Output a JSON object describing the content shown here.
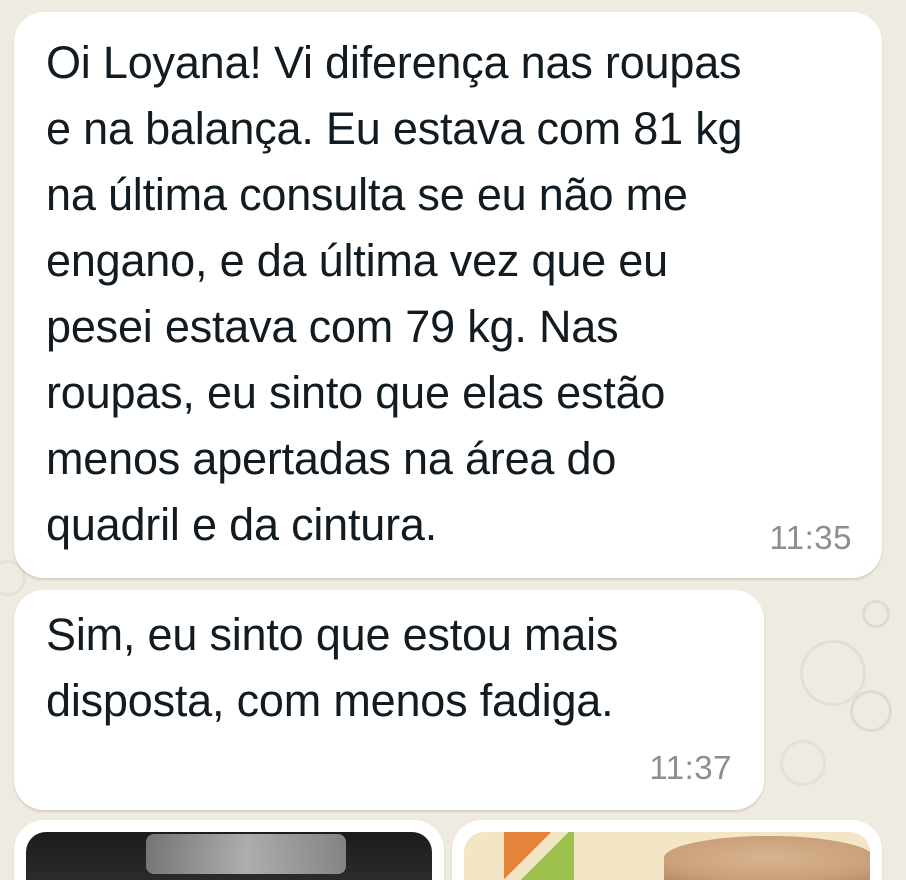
{
  "messages": [
    {
      "text": "Oi Loyana! Vi diferença nas roupas\ne na balança. Eu estava com 81 kg\nna última consulta se eu não me\nengano, e da última vez que eu\npesei estava com 79 kg. Nas\nroupas, eu sinto que elas estão\nmenos apertadas na área do\nquadril e da cintura.",
      "time": "11:35"
    },
    {
      "text": "Sim, eu sinto que estou mais\ndisposta, com menos fadiga.",
      "time": "11:37"
    }
  ],
  "media": [
    {
      "icon": "photo-thumbnail"
    },
    {
      "icon": "photo-thumbnail"
    }
  ],
  "colors": {
    "background": "#efeae2",
    "bubble": "#ffffff",
    "text": "#111b21",
    "time": "#8a8f93"
  }
}
